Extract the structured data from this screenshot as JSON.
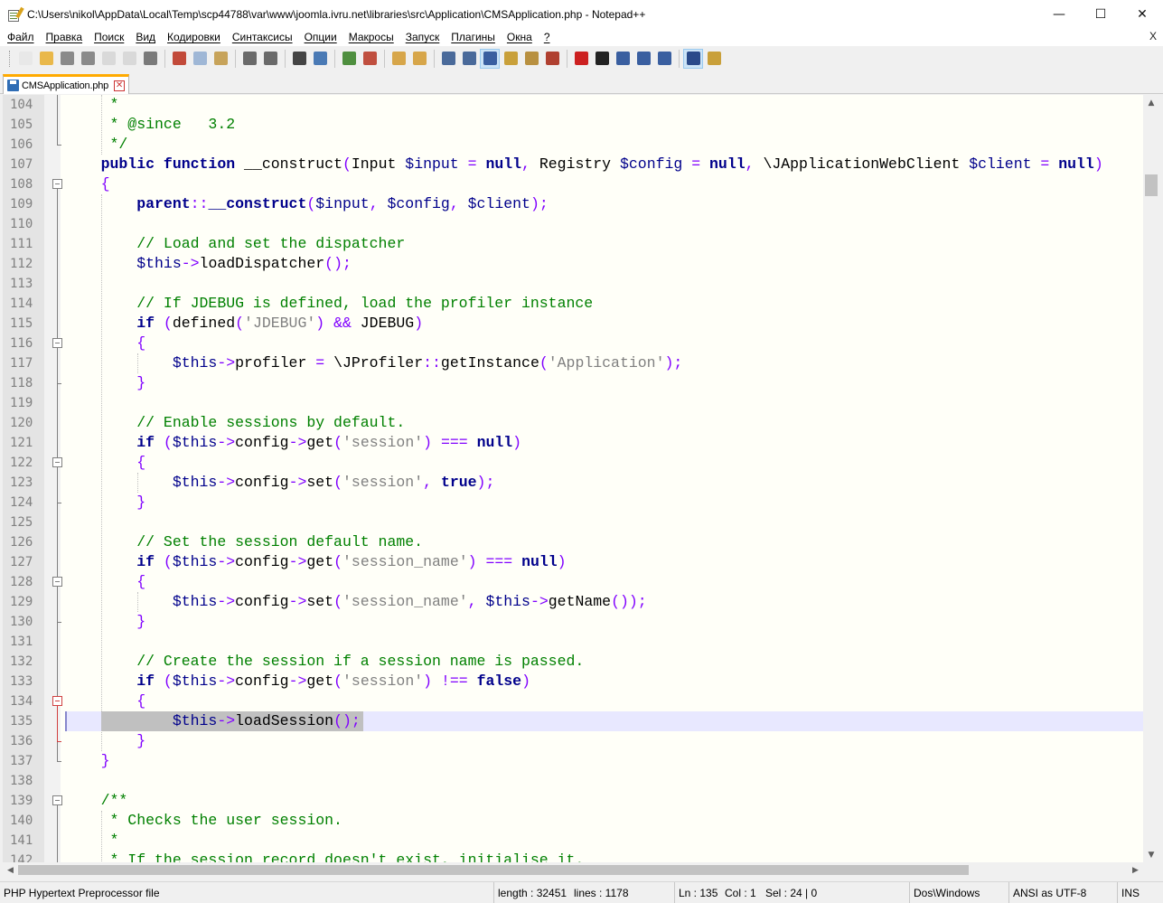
{
  "window": {
    "title": "C:\\Users\\nikol\\AppData\\Local\\Temp\\scp44788\\var\\www\\joomla.ivru.net\\libraries\\src\\Application\\CMSApplication.php - Notepad++",
    "minimize": "—",
    "maximize": "☐",
    "close": "✕"
  },
  "menu": {
    "items": [
      "Файл",
      "Правка",
      "Поиск",
      "Вид",
      "Кодировки",
      "Синтаксисы",
      "Опции",
      "Макросы",
      "Запуск",
      "Плагины",
      "Окна",
      "?"
    ],
    "close_doc": "X"
  },
  "toolbar": {
    "buttons": [
      {
        "icon": "new-file-icon",
        "color": "#e8e8e8"
      },
      {
        "icon": "open-file-icon",
        "color": "#e9b84a"
      },
      {
        "icon": "save-icon",
        "color": "#8a8a8a"
      },
      {
        "icon": "save-all-icon",
        "color": "#8a8a8a"
      },
      {
        "icon": "close-icon",
        "color": "#d9d9d9"
      },
      {
        "icon": "close-all-icon",
        "color": "#d9d9d9"
      },
      {
        "icon": "print-icon",
        "color": "#7a7a7a"
      },
      {
        "icon": "cut-icon",
        "color": "#c24a3a"
      },
      {
        "icon": "copy-icon",
        "color": "#9fb7d6"
      },
      {
        "icon": "paste-icon",
        "color": "#c7a35a"
      },
      {
        "icon": "undo-icon",
        "color": "#6a6a6a"
      },
      {
        "icon": "redo-icon",
        "color": "#6a6a6a"
      },
      {
        "icon": "find-icon",
        "color": "#444444"
      },
      {
        "icon": "replace-icon",
        "color": "#4a7ab5"
      },
      {
        "icon": "zoom-in-icon",
        "color": "#4f8f3f"
      },
      {
        "icon": "zoom-out-icon",
        "color": "#c04f3f"
      },
      {
        "icon": "sync-vertical-icon",
        "color": "#d7a64a"
      },
      {
        "icon": "sync-horizontal-icon",
        "color": "#d7a64a"
      },
      {
        "icon": "word-wrap-icon",
        "color": "#4a6a9a"
      },
      {
        "icon": "show-all-chars-icon",
        "color": "#4a6a9a"
      },
      {
        "icon": "indent-guide-icon",
        "color": "#3a5fa0"
      },
      {
        "icon": "udl-icon",
        "color": "#c9a03a"
      },
      {
        "icon": "doc-map-icon",
        "color": "#b89040"
      },
      {
        "icon": "function-list-icon",
        "color": "#b04030"
      },
      {
        "icon": "record-macro-icon",
        "color": "#cc2020"
      },
      {
        "icon": "stop-record-icon",
        "color": "#222222"
      },
      {
        "icon": "play-macro-icon",
        "color": "#3a5fa0"
      },
      {
        "icon": "run-macro-multiple-icon",
        "color": "#3a5fa0"
      },
      {
        "icon": "save-macro-icon",
        "color": "#3a5fa0"
      },
      {
        "icon": "spell-check-icon",
        "color": "#2a4a8a"
      },
      {
        "icon": "spell-settings-icon",
        "color": "#c9a03a"
      }
    ]
  },
  "tab": {
    "label": "CMSApplication.php",
    "close": "✕"
  },
  "editor": {
    "current_line": 135,
    "lines": [
      {
        "n": "104",
        "t": [
          [
            "dc",
            "     *"
          ]
        ]
      },
      {
        "n": "105",
        "t": [
          [
            "dc",
            "     * @since   3.2"
          ]
        ]
      },
      {
        "n": "106",
        "t": [
          [
            "dc",
            "     */"
          ]
        ]
      },
      {
        "n": "107",
        "t": [
          [
            "kw",
            "    public function "
          ],
          [
            "fn",
            "__construct"
          ],
          [
            "op",
            "("
          ],
          [
            "cs",
            "Input "
          ],
          [
            "vr",
            "$input"
          ],
          [
            "op",
            " = "
          ],
          [
            "kw",
            "null"
          ],
          [
            "op",
            ", "
          ],
          [
            "cs",
            "Registry "
          ],
          [
            "vr",
            "$config"
          ],
          [
            "op",
            " = "
          ],
          [
            "kw",
            "null"
          ],
          [
            "op",
            ", "
          ],
          [
            "cs",
            "\\JApplicationWebClient "
          ],
          [
            "vr",
            "$client"
          ],
          [
            "op",
            " = "
          ],
          [
            "kw",
            "null"
          ],
          [
            "op",
            ")"
          ]
        ]
      },
      {
        "n": "108",
        "t": [
          [
            "br",
            "    {"
          ]
        ]
      },
      {
        "n": "109",
        "t": [
          [
            "kw",
            "        parent"
          ],
          [
            "op",
            "::"
          ],
          [
            "kw",
            "__construct"
          ],
          [
            "op",
            "("
          ],
          [
            "vr",
            "$input"
          ],
          [
            "op",
            ", "
          ],
          [
            "vr",
            "$config"
          ],
          [
            "op",
            ", "
          ],
          [
            "vr",
            "$client"
          ],
          [
            "op",
            ");"
          ]
        ]
      },
      {
        "n": "110",
        "t": []
      },
      {
        "n": "111",
        "t": [
          [
            "cm",
            "        // Load and set the dispatcher"
          ]
        ]
      },
      {
        "n": "112",
        "t": [
          [
            "vr",
            "        $this"
          ],
          [
            "op",
            "->"
          ],
          [
            "cs",
            "loadDispatcher"
          ],
          [
            "op",
            "();"
          ]
        ]
      },
      {
        "n": "113",
        "t": []
      },
      {
        "n": "114",
        "t": [
          [
            "cm",
            "        // If JDEBUG is defined, load the profiler instance"
          ]
        ]
      },
      {
        "n": "115",
        "t": [
          [
            "kw",
            "        if "
          ],
          [
            "op",
            "("
          ],
          [
            "cs",
            "defined"
          ],
          [
            "op",
            "("
          ],
          [
            "st",
            "'JDEBUG'"
          ],
          [
            "op",
            ") && "
          ],
          [
            "cs",
            "JDEBUG"
          ],
          [
            "op",
            ")"
          ]
        ]
      },
      {
        "n": "116",
        "t": [
          [
            "br",
            "        {"
          ]
        ]
      },
      {
        "n": "117",
        "t": [
          [
            "vr",
            "            $this"
          ],
          [
            "op",
            "->"
          ],
          [
            "cs",
            "profiler "
          ],
          [
            "op",
            "= "
          ],
          [
            "cs",
            "\\JProfiler"
          ],
          [
            "op",
            "::"
          ],
          [
            "cs",
            "getInstance"
          ],
          [
            "op",
            "("
          ],
          [
            "st",
            "'Application'"
          ],
          [
            "op",
            ");"
          ]
        ]
      },
      {
        "n": "118",
        "t": [
          [
            "br",
            "        }"
          ]
        ]
      },
      {
        "n": "119",
        "t": []
      },
      {
        "n": "120",
        "t": [
          [
            "cm",
            "        // Enable sessions by default."
          ]
        ]
      },
      {
        "n": "121",
        "t": [
          [
            "kw",
            "        if "
          ],
          [
            "op",
            "("
          ],
          [
            "vr",
            "$this"
          ],
          [
            "op",
            "->"
          ],
          [
            "cs",
            "config"
          ],
          [
            "op",
            "->"
          ],
          [
            "cs",
            "get"
          ],
          [
            "op",
            "("
          ],
          [
            "st",
            "'session'"
          ],
          [
            "op",
            ") === "
          ],
          [
            "kw",
            "null"
          ],
          [
            "op",
            ")"
          ]
        ]
      },
      {
        "n": "122",
        "t": [
          [
            "br",
            "        {"
          ]
        ]
      },
      {
        "n": "123",
        "t": [
          [
            "vr",
            "            $this"
          ],
          [
            "op",
            "->"
          ],
          [
            "cs",
            "config"
          ],
          [
            "op",
            "->"
          ],
          [
            "cs",
            "set"
          ],
          [
            "op",
            "("
          ],
          [
            "st",
            "'session'"
          ],
          [
            "op",
            ", "
          ],
          [
            "kw",
            "true"
          ],
          [
            "op",
            ");"
          ]
        ]
      },
      {
        "n": "124",
        "t": [
          [
            "br",
            "        }"
          ]
        ]
      },
      {
        "n": "125",
        "t": []
      },
      {
        "n": "126",
        "t": [
          [
            "cm",
            "        // Set the session default name."
          ]
        ]
      },
      {
        "n": "127",
        "t": [
          [
            "kw",
            "        if "
          ],
          [
            "op",
            "("
          ],
          [
            "vr",
            "$this"
          ],
          [
            "op",
            "->"
          ],
          [
            "cs",
            "config"
          ],
          [
            "op",
            "->"
          ],
          [
            "cs",
            "get"
          ],
          [
            "op",
            "("
          ],
          [
            "st",
            "'session_name'"
          ],
          [
            "op",
            ") === "
          ],
          [
            "kw",
            "null"
          ],
          [
            "op",
            ")"
          ]
        ]
      },
      {
        "n": "128",
        "t": [
          [
            "br",
            "        {"
          ]
        ]
      },
      {
        "n": "129",
        "t": [
          [
            "vr",
            "            $this"
          ],
          [
            "op",
            "->"
          ],
          [
            "cs",
            "config"
          ],
          [
            "op",
            "->"
          ],
          [
            "cs",
            "set"
          ],
          [
            "op",
            "("
          ],
          [
            "st",
            "'session_name'"
          ],
          [
            "op",
            ", "
          ],
          [
            "vr",
            "$this"
          ],
          [
            "op",
            "->"
          ],
          [
            "cs",
            "getName"
          ],
          [
            "op",
            "());"
          ]
        ]
      },
      {
        "n": "130",
        "t": [
          [
            "br",
            "        }"
          ]
        ]
      },
      {
        "n": "131",
        "t": []
      },
      {
        "n": "132",
        "t": [
          [
            "cm",
            "        // Create the session if a session name is passed."
          ]
        ]
      },
      {
        "n": "133",
        "t": [
          [
            "kw",
            "        if "
          ],
          [
            "op",
            "("
          ],
          [
            "vr",
            "$this"
          ],
          [
            "op",
            "->"
          ],
          [
            "cs",
            "config"
          ],
          [
            "op",
            "->"
          ],
          [
            "cs",
            "get"
          ],
          [
            "op",
            "("
          ],
          [
            "st",
            "'session'"
          ],
          [
            "op",
            ") !== "
          ],
          [
            "kw",
            "false"
          ],
          [
            "op",
            ")"
          ]
        ]
      },
      {
        "n": "134",
        "t": [
          [
            "br",
            "        {"
          ]
        ]
      },
      {
        "n": "135",
        "t": [
          [
            "vr",
            "            $this"
          ],
          [
            "op",
            "->"
          ],
          [
            "cs",
            "loadSession"
          ],
          [
            "op",
            "();"
          ]
        ]
      },
      {
        "n": "136",
        "t": [
          [
            "br",
            "        }"
          ]
        ]
      },
      {
        "n": "137",
        "t": [
          [
            "br",
            "    }"
          ]
        ]
      },
      {
        "n": "138",
        "t": []
      },
      {
        "n": "139",
        "t": [
          [
            "dc",
            "    /**"
          ]
        ]
      },
      {
        "n": "140",
        "t": [
          [
            "dc",
            "     * Checks the user session."
          ]
        ]
      },
      {
        "n": "141",
        "t": [
          [
            "dc",
            "     *"
          ]
        ]
      },
      {
        "n": "142",
        "t": [
          [
            "dc",
            "     * If the session record doesn't exist, initialise it."
          ]
        ]
      }
    ]
  },
  "statusbar": {
    "file_type": "PHP Hypertext Preprocessor file",
    "length": "length : 32451",
    "lines": "lines : 1178",
    "ln": "Ln : 135",
    "col": "Col : 1",
    "sel": "Sel : 24 | 0",
    "eol": "Dos\\Windows",
    "encoding": "ANSI as UTF-8",
    "mode": "INS"
  },
  "scrollbar": {
    "up": "▲",
    "down": "▼",
    "left": "◀",
    "right": "▶"
  }
}
